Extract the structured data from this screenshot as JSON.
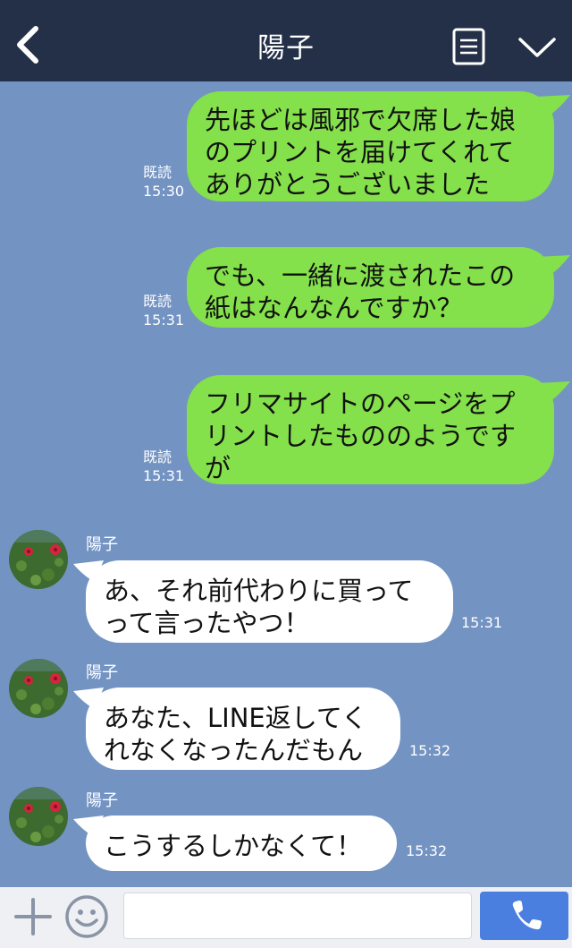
{
  "header": {
    "title": "陽子",
    "back_icon": "chevron-left-icon",
    "menu_icon": "document-menu-icon",
    "expand_icon": "chevron-down-icon"
  },
  "messages": [
    {
      "direction": "out",
      "text": "先ほどは風邪で欠席した娘\nのプリントを届けてくれて\nありがとうございました",
      "read": "既読",
      "time": "15:30"
    },
    {
      "direction": "out",
      "text": "でも、一緒に渡されたこの\n紙はなんなんですか？",
      "read": "既読",
      "time": "15:31"
    },
    {
      "direction": "out",
      "text": "フリマサイトのページをプ\nリントしたもののようです\nが",
      "read": "既読",
      "time": "15:31"
    },
    {
      "direction": "in",
      "sender": "陽子",
      "text": "あ、それ前代わりに買って\nって言ったやつ！",
      "time": "15:31"
    },
    {
      "direction": "in",
      "sender": "陽子",
      "text": "あなた、LINE返してく\nれなくなったんだもん",
      "time": "15:32"
    },
    {
      "direction": "in",
      "sender": "陽子",
      "text": "こうするしかなくて！",
      "time": "15:32"
    }
  ],
  "input": {
    "placeholder": "",
    "value": ""
  },
  "colors": {
    "header_bg": "#243047",
    "chat_bg": "#7393c3",
    "outgoing_bubble": "#84e04b",
    "incoming_bubble": "#ffffff",
    "call_button": "#4a7fe0"
  }
}
